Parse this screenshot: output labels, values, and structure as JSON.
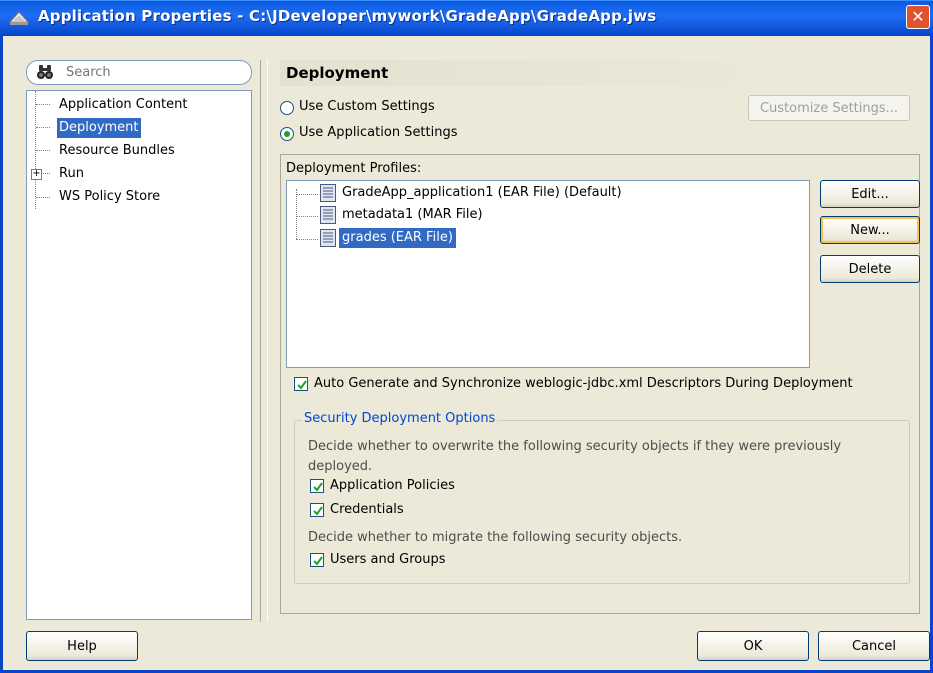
{
  "window": {
    "title": "Application Properties - C:\\JDeveloper\\mywork\\GradeApp\\GradeApp.jws",
    "close_glyph": "✕",
    "accent": "#0a5ae0"
  },
  "search": {
    "placeholder": "Search",
    "icon": "binoculars-icon"
  },
  "nav": {
    "items": [
      {
        "label": "Application Content",
        "selected": false
      },
      {
        "label": "Deployment",
        "selected": true
      },
      {
        "label": "Resource Bundles",
        "selected": false
      },
      {
        "label": "Run",
        "selected": false,
        "expandable": true
      },
      {
        "label": "WS Policy Store",
        "selected": false
      }
    ],
    "expander_glyph": "+"
  },
  "deployment": {
    "header": "Deployment",
    "use_custom_settings": "Use Custom Settings",
    "use_application_settings": "Use Application Settings",
    "selected_option": "use_application_settings",
    "customize_button": "Customize Settings...",
    "profiles_label": "Deployment Profiles:",
    "profiles": [
      {
        "label": "GradeApp_application1 (EAR File) (Default)",
        "selected": false
      },
      {
        "label": "metadata1 (MAR File)",
        "selected": false
      },
      {
        "label": "grades (EAR File)",
        "selected": true
      }
    ],
    "edit_button": "Edit...",
    "new_button": "New...",
    "delete_button": "Delete",
    "auto_generate_label": "Auto Generate and Synchronize weblogic-jdbc.xml Descriptors During Deployment",
    "auto_generate_checked": true
  },
  "security": {
    "legend": "Security Deployment Options",
    "overwrite_desc": "Decide whether to overwrite the following security objects if they were previously deployed.",
    "application_policies": "Application Policies",
    "credentials": "Credentials",
    "migrate_desc": "Decide whether to migrate the following security objects.",
    "users_and_groups": "Users and Groups",
    "checked": [
      true,
      true,
      true
    ]
  },
  "footer": {
    "help_button": "Help",
    "ok_button": "OK",
    "cancel_button": "Cancel"
  }
}
